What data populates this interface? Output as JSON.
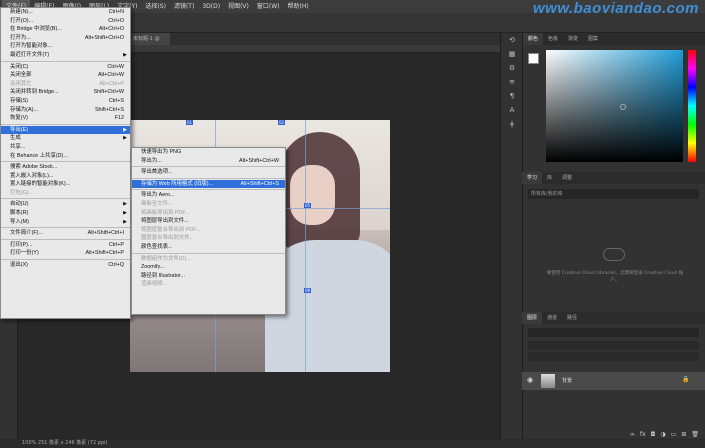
{
  "menubar": {
    "items": [
      "文件(F)",
      "编辑(E)",
      "图像(I)",
      "图层(L)",
      "文字(Y)",
      "选择(S)",
      "滤镜(T)",
      "3D(D)",
      "视图(V)",
      "窗口(W)",
      "帮助(H)"
    ]
  },
  "watermark": "www.baoyiandao.com",
  "document_tab": "未标题-1 @",
  "file_menu": [
    {
      "label": "新建(N)...",
      "shortcut": "Ctrl+N"
    },
    {
      "label": "打开(O)...",
      "shortcut": "Ctrl+O"
    },
    {
      "label": "在 Bridge 中浏览(B)...",
      "shortcut": "Alt+Ctrl+O"
    },
    {
      "label": "打开为...",
      "shortcut": "Alt+Shift+Ctrl+O"
    },
    {
      "label": "打开为智能对象...",
      "shortcut": ""
    },
    {
      "label": "最近打开文件(T)",
      "shortcut": "",
      "submenu": true
    },
    {
      "sep": true
    },
    {
      "label": "关闭(C)",
      "shortcut": "Ctrl+W"
    },
    {
      "label": "关闭全部",
      "shortcut": "Alt+Ctrl+W"
    },
    {
      "label": "关闭其它",
      "shortcut": "Alt+Ctrl+P",
      "disabled": true
    },
    {
      "label": "关闭并转到 Bridge...",
      "shortcut": "Shift+Ctrl+W"
    },
    {
      "label": "存储(S)",
      "shortcut": "Ctrl+S"
    },
    {
      "label": "存储为(A)...",
      "shortcut": "Shift+Ctrl+S"
    },
    {
      "label": "恢复(V)",
      "shortcut": "F12"
    },
    {
      "sep": true
    },
    {
      "label": "导出(E)",
      "shortcut": "",
      "submenu": true,
      "highlight": true
    },
    {
      "label": "生成",
      "shortcut": "",
      "submenu": true
    },
    {
      "label": "共享...",
      "shortcut": ""
    },
    {
      "label": "在 Behance 上共享(D)...",
      "shortcut": ""
    },
    {
      "sep": true
    },
    {
      "label": "搜索 Adobe Stock...",
      "shortcut": ""
    },
    {
      "label": "置入嵌入对象(L)...",
      "shortcut": ""
    },
    {
      "label": "置入链接的智能对象(K)...",
      "shortcut": ""
    },
    {
      "label": "打包(G)...",
      "shortcut": "",
      "disabled": true
    },
    {
      "sep": true
    },
    {
      "label": "自动(U)",
      "shortcut": "",
      "submenu": true
    },
    {
      "label": "脚本(R)",
      "shortcut": "",
      "submenu": true
    },
    {
      "label": "导入(M)",
      "shortcut": "",
      "submenu": true
    },
    {
      "sep": true
    },
    {
      "label": "文件简介(F)...",
      "shortcut": "Alt+Shift+Ctrl+I"
    },
    {
      "sep": true
    },
    {
      "label": "打印(P)...",
      "shortcut": "Ctrl+P"
    },
    {
      "label": "打印一份(Y)",
      "shortcut": "Alt+Shift+Ctrl+P"
    },
    {
      "sep": true
    },
    {
      "label": "退出(X)",
      "shortcut": "Ctrl+Q"
    }
  ],
  "export_submenu": [
    {
      "label": "快速导出为 PNG",
      "shortcut": ""
    },
    {
      "label": "导出为...",
      "shortcut": "Alt+Shift+Ctrl+W"
    },
    {
      "sep": true
    },
    {
      "label": "导出首选项...",
      "shortcut": ""
    },
    {
      "sep": true
    },
    {
      "label": "存储为 Web 所用格式 (旧版)...",
      "shortcut": "Alt+Shift+Ctrl+S",
      "highlight": true
    },
    {
      "sep": true
    },
    {
      "label": "导出为 Aero...",
      "shortcut": ""
    },
    {
      "label": "画板至文件...",
      "shortcut": "",
      "disabled": true
    },
    {
      "label": "将画板导出到 PDF...",
      "shortcut": "",
      "disabled": true
    },
    {
      "label": "将图层导出到文件...",
      "shortcut": ""
    },
    {
      "label": "将图层复合导出到 PDF...",
      "shortcut": "",
      "disabled": true
    },
    {
      "label": "图层复合导出到文件...",
      "shortcut": "",
      "disabled": true
    },
    {
      "label": "颜色查找表...",
      "shortcut": ""
    },
    {
      "sep": true
    },
    {
      "label": "数据组作为文件(D)...",
      "shortcut": "",
      "disabled": true
    },
    {
      "label": "Zoomify...",
      "shortcut": ""
    },
    {
      "label": "路径到 Illustrator...",
      "shortcut": ""
    },
    {
      "label": "渲染视频...",
      "shortcut": "",
      "disabled": true
    }
  ],
  "right_panel": {
    "color_tabs": [
      "颜色",
      "色板",
      "渐变",
      "图案"
    ],
    "learn_tabs": [
      "学习",
      "库",
      "调整"
    ],
    "library_dropdown": "所有库/我的库",
    "library_message": "要使用 Creative Cloud Libraries，您需要登录 Creative Cloud 账户。",
    "layer_tabs": [
      "图层",
      "通道",
      "路径"
    ],
    "layer_name": "背景"
  },
  "status": "100%    251 像素 x 246 像素 (72 ppi)"
}
